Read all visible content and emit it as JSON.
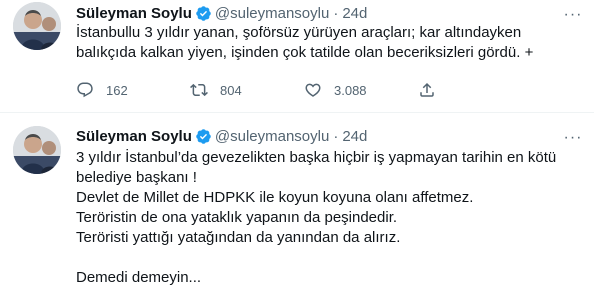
{
  "tweets": [
    {
      "author_name": "Süleyman Soylu",
      "handle": "@suleymansoylu",
      "separator": "·",
      "time": "24d",
      "more": "···",
      "lines": [
        "İstanbullu 3 yıldır yanan, şoförsüz yürüyen araçları; kar altındayken",
        "balıkçıda kalkan yiyen, işinden çok tatilde olan beceriksizleri gördü. +"
      ],
      "replies": "162",
      "retweets": "804",
      "likes": "3.088"
    },
    {
      "author_name": "Süleyman Soylu",
      "handle": "@suleymansoylu",
      "separator": "·",
      "time": "24d",
      "more": "···",
      "lines": [
        "3 yıldır İstanbul’da gevezelikten başka hiçbir iş yapmayan tarihin en kötü",
        "belediye başkanı !",
        "Devlet de Millet de HDPKK ile koyun koyuna olanı affetmez.",
        "Teröristin de ona yataklık yapanın da peşindedir.",
        "Teröristi yattığı yatağından da yanından da alırız.",
        "",
        "Demedi demeyin..."
      ]
    }
  ],
  "colors": {
    "text": "#0f1419",
    "secondary": "#536471",
    "verified": "#1d9bf0",
    "divider": "#eff3f4"
  },
  "icons": {
    "verified": "verified-badge-icon",
    "reply": "reply-icon",
    "retweet": "retweet-icon",
    "like": "heart-icon",
    "more": "more-icon"
  }
}
